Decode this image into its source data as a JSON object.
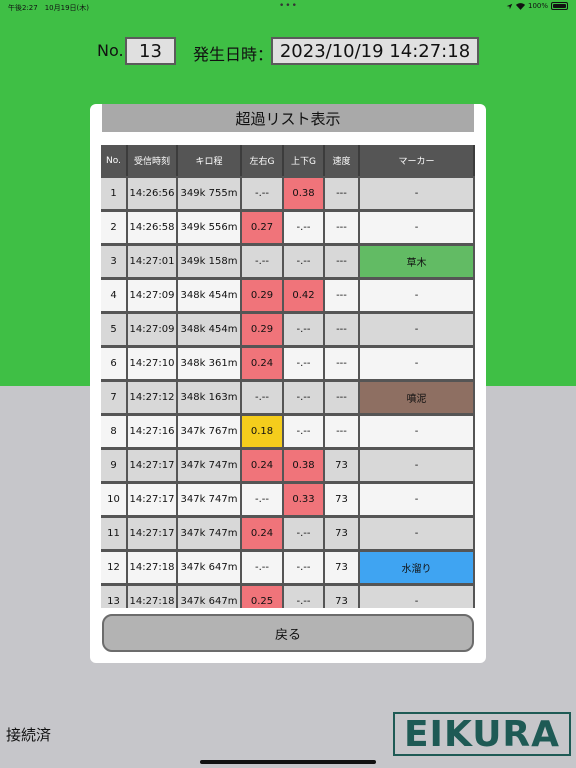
{
  "status_bar": {
    "time_date": "午後2:27　10月19日(木)",
    "dots": "•••",
    "battery": "100%"
  },
  "header": {
    "no_label": "No.",
    "no_value": "13",
    "datetime_label": "発生日時：",
    "datetime_value": "2023/10/19 14:27:18"
  },
  "modal": {
    "title": "超過リスト表示",
    "columns": [
      "No.",
      "受信時刻",
      "キロ程",
      "左右G",
      "上下G",
      "速度",
      "マーカー"
    ],
    "rows": [
      [
        "1",
        "14:26:56",
        "349k 755m",
        "-.--",
        "0.38",
        "---",
        "-"
      ],
      [
        "2",
        "14:26:58",
        "349k 556m",
        "0.27",
        "-.--",
        "---",
        "-"
      ],
      [
        "3",
        "14:27:01",
        "349k 158m",
        "-.--",
        "-.--",
        "---",
        "草木"
      ],
      [
        "4",
        "14:27:09",
        "348k 454m",
        "0.29",
        "0.42",
        "---",
        "-"
      ],
      [
        "5",
        "14:27:09",
        "348k 454m",
        "0.29",
        "-.--",
        "---",
        "-"
      ],
      [
        "6",
        "14:27:10",
        "348k 361m",
        "0.24",
        "-.--",
        "---",
        "-"
      ],
      [
        "7",
        "14:27:12",
        "348k 163m",
        "-.--",
        "-.--",
        "---",
        "噴泥"
      ],
      [
        "8",
        "14:27:16",
        "347k 767m",
        "0.18",
        "-.--",
        "---",
        "-"
      ],
      [
        "9",
        "14:27:17",
        "347k 747m",
        "0.24",
        "0.38",
        "73",
        "-"
      ],
      [
        "10",
        "14:27:17",
        "347k 747m",
        "-.--",
        "0.33",
        "73",
        "-"
      ],
      [
        "11",
        "14:27:17",
        "347k 747m",
        "0.24",
        "-.--",
        "73",
        "-"
      ],
      [
        "12",
        "14:27:18",
        "347k 647m",
        "-.--",
        "-.--",
        "73",
        "水溜り"
      ],
      [
        "13",
        "14:27:18",
        "347k 647m",
        "0.25",
        "-.--",
        "73",
        "-"
      ]
    ],
    "row_colors": {
      "odd": "#d8d8d8",
      "even": "#f5f5f5",
      "alert_red": "#f0747a",
      "alert_yellow": "#f5cd1c",
      "marker_green": "#62bb64",
      "marker_brown": "#8e6f62",
      "marker_blue": "#3fa4f2"
    },
    "back_label": "戻る"
  },
  "footer": {
    "connection_status": "接続済",
    "logo_text": "EIKURA"
  },
  "colors": {
    "upper_background": "#3fbf45",
    "lower_background": "#c6c6ca"
  }
}
